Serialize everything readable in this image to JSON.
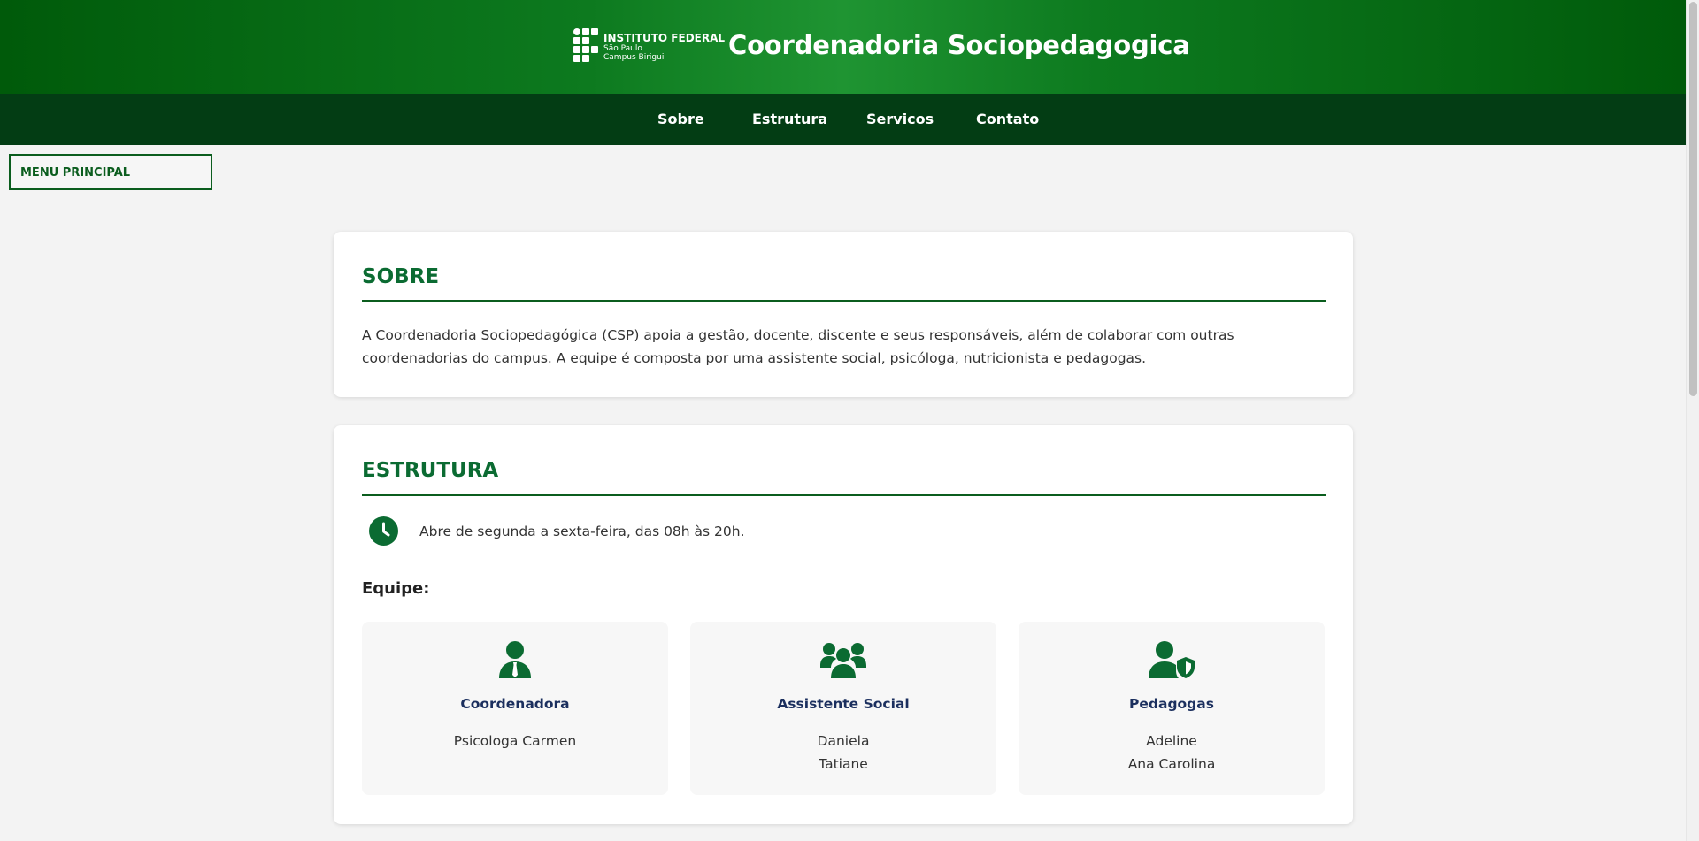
{
  "header": {
    "logo": {
      "line1": "INSTITUTO FEDERAL",
      "line2": "São Paulo",
      "line3": "Campus Birigui"
    },
    "title": "Coordenadoria Sociopedagogica"
  },
  "nav": {
    "items": [
      "Sobre",
      "Estrutura",
      "Servicos",
      "Contato"
    ]
  },
  "menu_button": "MENU PRINCIPAL",
  "sobre": {
    "heading": "SOBRE",
    "text": "A Coordenadoria Sociopedagógica (CSP) apoia a gestão, docente, discente e seus responsáveis, além de colaborar com outras coordenadorias do campus. A equipe é composta por uma assistente social, psicóloga, nutricionista e pedagogas."
  },
  "estrutura": {
    "heading": "ESTRUTURA",
    "hours_icon": "clock-icon",
    "hours": "Abre de segunda a sexta-feira, das 08h às 20h.",
    "team_label": "Equipe:",
    "team": [
      {
        "icon": "user-tie-icon",
        "role": "Coordenadora",
        "members": [
          "Psicologa Carmen"
        ]
      },
      {
        "icon": "users-icon",
        "role": "Assistente Social",
        "members": [
          "Daniela",
          "Tatiane"
        ]
      },
      {
        "icon": "user-shield-icon",
        "role": "Pedagogas",
        "members": [
          "Adeline",
          "Ana Carolina"
        ]
      }
    ]
  },
  "colors": {
    "header_green": "#0d7a1f",
    "nav_green": "#033d14",
    "heading_green": "#0b6b32",
    "role_blue": "#1b2f5e"
  }
}
